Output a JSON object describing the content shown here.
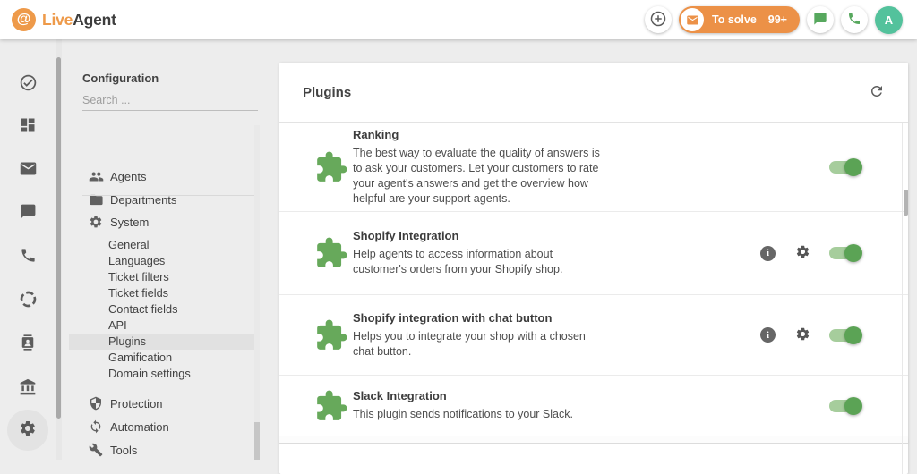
{
  "colors": {
    "brand_orange": "#EE9A4A",
    "pill_orange": "#EC9147",
    "plugin_green": "#67A95B",
    "toggle_track_green": "#A6CD9C",
    "toggle_knob_green": "#5BA355",
    "avatar_green": "#53C29C",
    "icon_gray": "#5c5c5c",
    "selected_row_bg": "#E1E1E1"
  },
  "header": {
    "logo_at": "@",
    "logo_live": "Live",
    "logo_agent": "Agent",
    "to_solve_label": "To solve",
    "to_solve_count": "99+",
    "avatar_letter": "A"
  },
  "icon_sidebar": {
    "icons": [
      "check-circle",
      "dashboard",
      "mail",
      "chat",
      "phone",
      "loop",
      "contacts",
      "bank",
      "settings"
    ],
    "active_icon": "settings"
  },
  "config": {
    "title": "Configuration",
    "search_placeholder": "Search ...",
    "search_value": "",
    "items": {
      "agents": "Agents",
      "departments": "Departments",
      "system": "System",
      "protection": "Protection",
      "automation": "Automation",
      "tools": "Tools"
    },
    "system_items": [
      "General",
      "Languages",
      "Ticket filters",
      "Ticket fields",
      "Contact fields",
      "API",
      "Plugins",
      "Gamification",
      "Domain settings"
    ],
    "selected_item": "Plugins"
  },
  "plugins_panel": {
    "title": "Plugins",
    "rows": [
      {
        "name": "Ranking",
        "description": "The best way to evaluate the quality of answers is to ask your customers. Let your customers to rate your agent's answers and get the overview how helpful are your support agents.",
        "enabled": true,
        "has_info": false,
        "has_settings": false
      },
      {
        "name": "Shopify Integration",
        "description": "Help agents to access information about customer's orders from your Shopify shop.",
        "enabled": true,
        "has_info": true,
        "has_settings": true
      },
      {
        "name": "Shopify integration with chat button",
        "description": "Helps you to integrate your shop with a chosen chat button.",
        "enabled": true,
        "has_info": true,
        "has_settings": true
      },
      {
        "name": "Slack Integration",
        "description": "This plugin sends notifications to your Slack.",
        "enabled": true,
        "has_info": false,
        "has_settings": false
      }
    ],
    "info_icon_glyph": "i"
  }
}
